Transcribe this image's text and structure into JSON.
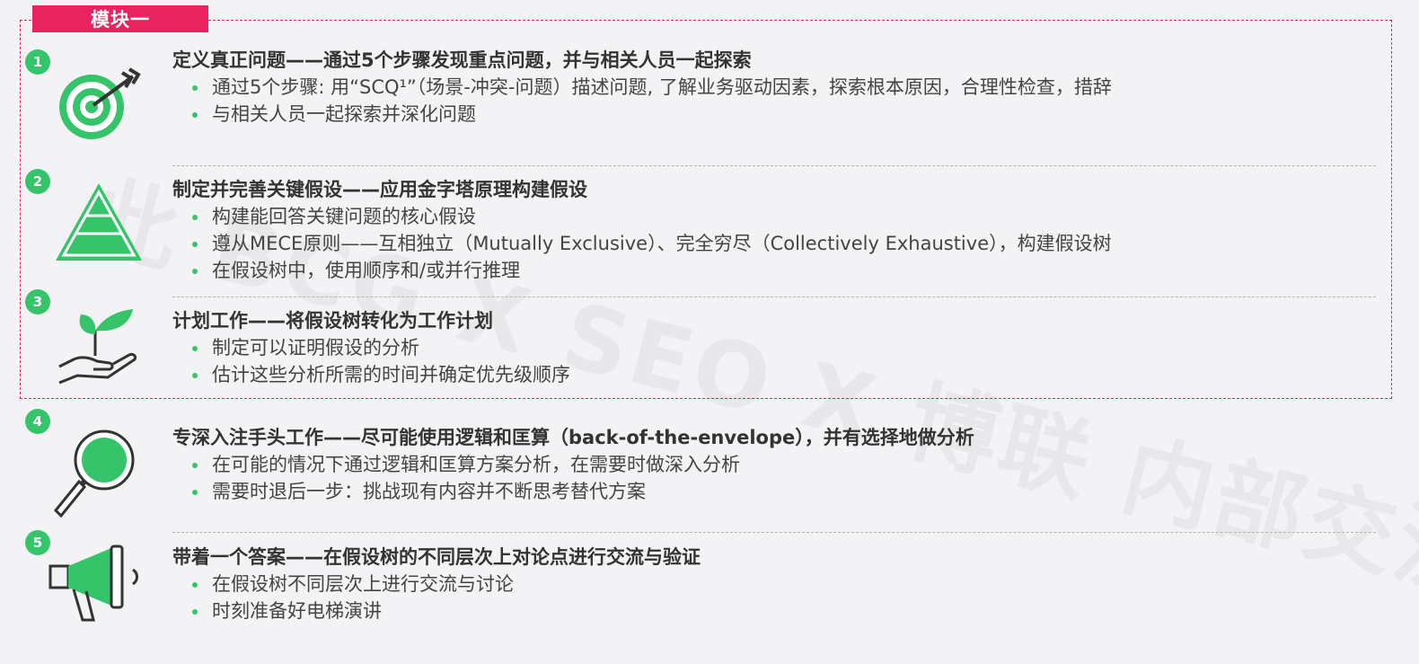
{
  "module_label": "模块一",
  "watermark": "此 BCG X SEO X 博联 内部交流使用",
  "accent_color": "#35c46a",
  "module_border_color": "#e8235f",
  "sections": [
    {
      "number": "1",
      "icon": "target-icon",
      "title": "定义真正问题——通过5个步骤发现重点问题，并与相关人员一起探索",
      "bullets": [
        "通过5个步骤: 用“SCQ¹”（场景-冲突-问题）描述问题, 了解业务驱动因素，探索根本原因，合理性检查，措辞",
        "与相关人员一起探索并深化问题"
      ]
    },
    {
      "number": "2",
      "icon": "pyramid-icon",
      "title": "制定并完善关键假设——应用金字塔原理构建假设",
      "bullets": [
        "构建能回答关键问题的核心假设",
        "遵从MECE原则——互相独立（Mutually Exclusive）、完全穷尽（Collectively Exhaustive），构建假设树",
        "在假设树中，使用顺序和/或并行推理"
      ]
    },
    {
      "number": "3",
      "icon": "plant-hand-icon",
      "title": "计划工作——将假设树转化为工作计划",
      "bullets": [
        "制定可以证明假设的分析",
        "估计这些分析所需的时间并确定优先级顺序"
      ]
    },
    {
      "number": "4",
      "icon": "magnifier-icon",
      "title": "专深入注手头工作——尽可能使用逻辑和匡算（back-of-the-envelope），并有选择地做分析",
      "bullets": [
        "在可能的情况下通过逻辑和匡算方案分析，在需要时做深入分析",
        "需要时退后一步：挑战现有内容并不断思考替代方案"
      ]
    },
    {
      "number": "5",
      "icon": "megaphone-icon",
      "title": "带着一个答案——在假设树的不同层次上对论点进行交流与验证",
      "bullets": [
        "在假设树不同层次上进行交流与讨论",
        "时刻准备好电梯演讲"
      ]
    }
  ]
}
